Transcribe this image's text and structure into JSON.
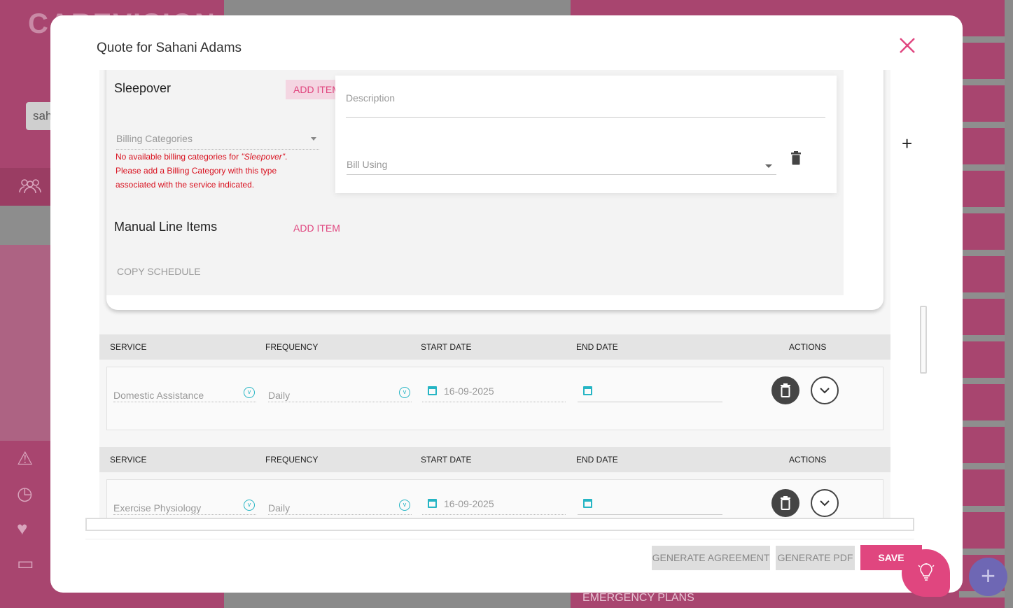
{
  "background": {
    "logo_text": "CAREVISION",
    "search_value": "sah",
    "emergency_label": "EMERGENCY PLANS"
  },
  "modal": {
    "title": "Quote for Sahani Adams",
    "accent_color": "#e0467f"
  },
  "billing": {
    "sleepover_label": "Sleepover",
    "add_item_label": "ADD ITEM",
    "billing_categories_placeholder": "Billing Categories",
    "error_prefix": "No available billing categories for ",
    "error_service": "\"Sleepover\"",
    "error_suffix": ". Please add a Billing Category with this type associated with the service indicated.",
    "description_placeholder": "Description",
    "bill_using_placeholder": "Bill Using",
    "manual_line_items_label": "Manual Line Items",
    "manual_add_item_label": "ADD ITEM",
    "copy_schedule_label": "COPY SCHEDULE"
  },
  "table_headers": {
    "service": "SERVICE",
    "frequency": "FREQUENCY",
    "start_date": "START DATE",
    "end_date": "END DATE",
    "actions": "ACTIONS"
  },
  "services": [
    {
      "service": "Domestic Assistance",
      "frequency": "Daily",
      "start_date": "16-09-2025",
      "end_date": ""
    },
    {
      "service": "Exercise Physiology",
      "frequency": "Daily",
      "start_date": "16-09-2025",
      "end_date": ""
    }
  ],
  "footer": {
    "generate_agreement_label": "GENERATE AGREEMENT",
    "generate_pdf_label": "GENERATE PDF",
    "save_label": "SAVE"
  }
}
